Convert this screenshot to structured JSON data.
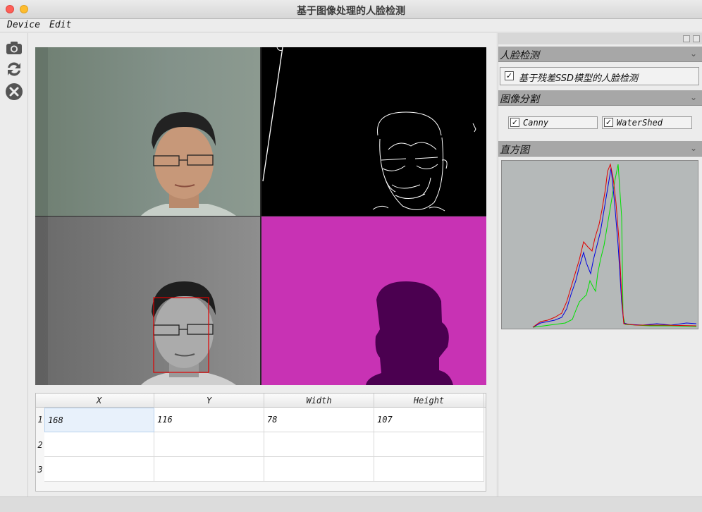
{
  "window": {
    "title": "基于图像处理的人脸检测"
  },
  "menu": {
    "device": "Device",
    "edit": "Edit"
  },
  "toolbar": {
    "capture_icon": "camera-icon",
    "refresh_icon": "refresh-icon",
    "close_icon": "close-icon"
  },
  "views": [
    {
      "name": "original-camera-view"
    },
    {
      "name": "canny-edge-view"
    },
    {
      "name": "face-detection-view"
    },
    {
      "name": "watershed-segmentation-view"
    }
  ],
  "table": {
    "columns": [
      "X",
      "Y",
      "Width",
      "Height"
    ],
    "rows": [
      {
        "index": "1",
        "cells": [
          "168",
          "116",
          "78",
          "107"
        ]
      },
      {
        "index": "2",
        "cells": [
          "",
          "",
          "",
          ""
        ]
      },
      {
        "index": "3",
        "cells": [
          "",
          "",
          "",
          ""
        ]
      }
    ]
  },
  "dock": {
    "face_detection": {
      "title": "人脸检测",
      "checkbox_label": "基于残差SSD模型的人脸检测",
      "checked": true
    },
    "segmentation": {
      "title": "图像分割",
      "canny_label": "Canny",
      "canny_checked": true,
      "watershed_label": "WaterShed",
      "watershed_checked": true
    },
    "histogram": {
      "title": "直方图"
    }
  },
  "colors": {
    "watershed_bg": "#c832b4",
    "watershed_fg": "#4b0050",
    "hist_red": "#e00000",
    "hist_green": "#00e000",
    "hist_blue": "#0000e0"
  }
}
